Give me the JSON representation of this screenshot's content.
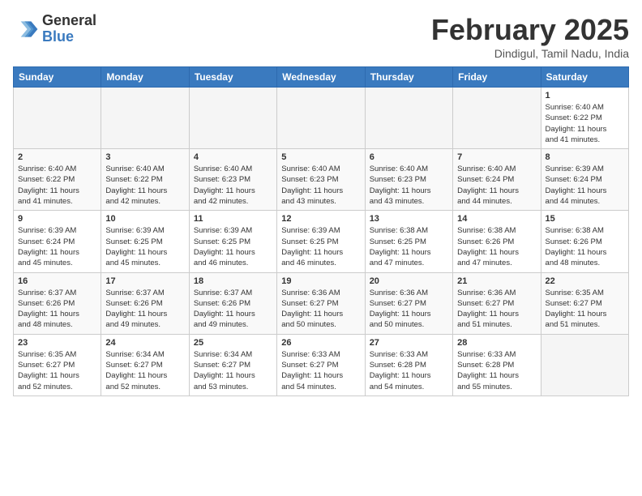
{
  "header": {
    "logo_general": "General",
    "logo_blue": "Blue",
    "month_title": "February 2025",
    "location": "Dindigul, Tamil Nadu, India"
  },
  "weekdays": [
    "Sunday",
    "Monday",
    "Tuesday",
    "Wednesday",
    "Thursday",
    "Friday",
    "Saturday"
  ],
  "weeks": [
    [
      {
        "day": "",
        "info": ""
      },
      {
        "day": "",
        "info": ""
      },
      {
        "day": "",
        "info": ""
      },
      {
        "day": "",
        "info": ""
      },
      {
        "day": "",
        "info": ""
      },
      {
        "day": "",
        "info": ""
      },
      {
        "day": "1",
        "info": "Sunrise: 6:40 AM\nSunset: 6:22 PM\nDaylight: 11 hours\nand 41 minutes."
      }
    ],
    [
      {
        "day": "2",
        "info": "Sunrise: 6:40 AM\nSunset: 6:22 PM\nDaylight: 11 hours\nand 41 minutes."
      },
      {
        "day": "3",
        "info": "Sunrise: 6:40 AM\nSunset: 6:22 PM\nDaylight: 11 hours\nand 42 minutes."
      },
      {
        "day": "4",
        "info": "Sunrise: 6:40 AM\nSunset: 6:23 PM\nDaylight: 11 hours\nand 42 minutes."
      },
      {
        "day": "5",
        "info": "Sunrise: 6:40 AM\nSunset: 6:23 PM\nDaylight: 11 hours\nand 43 minutes."
      },
      {
        "day": "6",
        "info": "Sunrise: 6:40 AM\nSunset: 6:23 PM\nDaylight: 11 hours\nand 43 minutes."
      },
      {
        "day": "7",
        "info": "Sunrise: 6:40 AM\nSunset: 6:24 PM\nDaylight: 11 hours\nand 44 minutes."
      },
      {
        "day": "8",
        "info": "Sunrise: 6:39 AM\nSunset: 6:24 PM\nDaylight: 11 hours\nand 44 minutes."
      }
    ],
    [
      {
        "day": "9",
        "info": "Sunrise: 6:39 AM\nSunset: 6:24 PM\nDaylight: 11 hours\nand 45 minutes."
      },
      {
        "day": "10",
        "info": "Sunrise: 6:39 AM\nSunset: 6:25 PM\nDaylight: 11 hours\nand 45 minutes."
      },
      {
        "day": "11",
        "info": "Sunrise: 6:39 AM\nSunset: 6:25 PM\nDaylight: 11 hours\nand 46 minutes."
      },
      {
        "day": "12",
        "info": "Sunrise: 6:39 AM\nSunset: 6:25 PM\nDaylight: 11 hours\nand 46 minutes."
      },
      {
        "day": "13",
        "info": "Sunrise: 6:38 AM\nSunset: 6:25 PM\nDaylight: 11 hours\nand 47 minutes."
      },
      {
        "day": "14",
        "info": "Sunrise: 6:38 AM\nSunset: 6:26 PM\nDaylight: 11 hours\nand 47 minutes."
      },
      {
        "day": "15",
        "info": "Sunrise: 6:38 AM\nSunset: 6:26 PM\nDaylight: 11 hours\nand 48 minutes."
      }
    ],
    [
      {
        "day": "16",
        "info": "Sunrise: 6:37 AM\nSunset: 6:26 PM\nDaylight: 11 hours\nand 48 minutes."
      },
      {
        "day": "17",
        "info": "Sunrise: 6:37 AM\nSunset: 6:26 PM\nDaylight: 11 hours\nand 49 minutes."
      },
      {
        "day": "18",
        "info": "Sunrise: 6:37 AM\nSunset: 6:26 PM\nDaylight: 11 hours\nand 49 minutes."
      },
      {
        "day": "19",
        "info": "Sunrise: 6:36 AM\nSunset: 6:27 PM\nDaylight: 11 hours\nand 50 minutes."
      },
      {
        "day": "20",
        "info": "Sunrise: 6:36 AM\nSunset: 6:27 PM\nDaylight: 11 hours\nand 50 minutes."
      },
      {
        "day": "21",
        "info": "Sunrise: 6:36 AM\nSunset: 6:27 PM\nDaylight: 11 hours\nand 51 minutes."
      },
      {
        "day": "22",
        "info": "Sunrise: 6:35 AM\nSunset: 6:27 PM\nDaylight: 11 hours\nand 51 minutes."
      }
    ],
    [
      {
        "day": "23",
        "info": "Sunrise: 6:35 AM\nSunset: 6:27 PM\nDaylight: 11 hours\nand 52 minutes."
      },
      {
        "day": "24",
        "info": "Sunrise: 6:34 AM\nSunset: 6:27 PM\nDaylight: 11 hours\nand 52 minutes."
      },
      {
        "day": "25",
        "info": "Sunrise: 6:34 AM\nSunset: 6:27 PM\nDaylight: 11 hours\nand 53 minutes."
      },
      {
        "day": "26",
        "info": "Sunrise: 6:33 AM\nSunset: 6:27 PM\nDaylight: 11 hours\nand 54 minutes."
      },
      {
        "day": "27",
        "info": "Sunrise: 6:33 AM\nSunset: 6:28 PM\nDaylight: 11 hours\nand 54 minutes."
      },
      {
        "day": "28",
        "info": "Sunrise: 6:33 AM\nSunset: 6:28 PM\nDaylight: 11 hours\nand 55 minutes."
      },
      {
        "day": "",
        "info": ""
      }
    ]
  ]
}
